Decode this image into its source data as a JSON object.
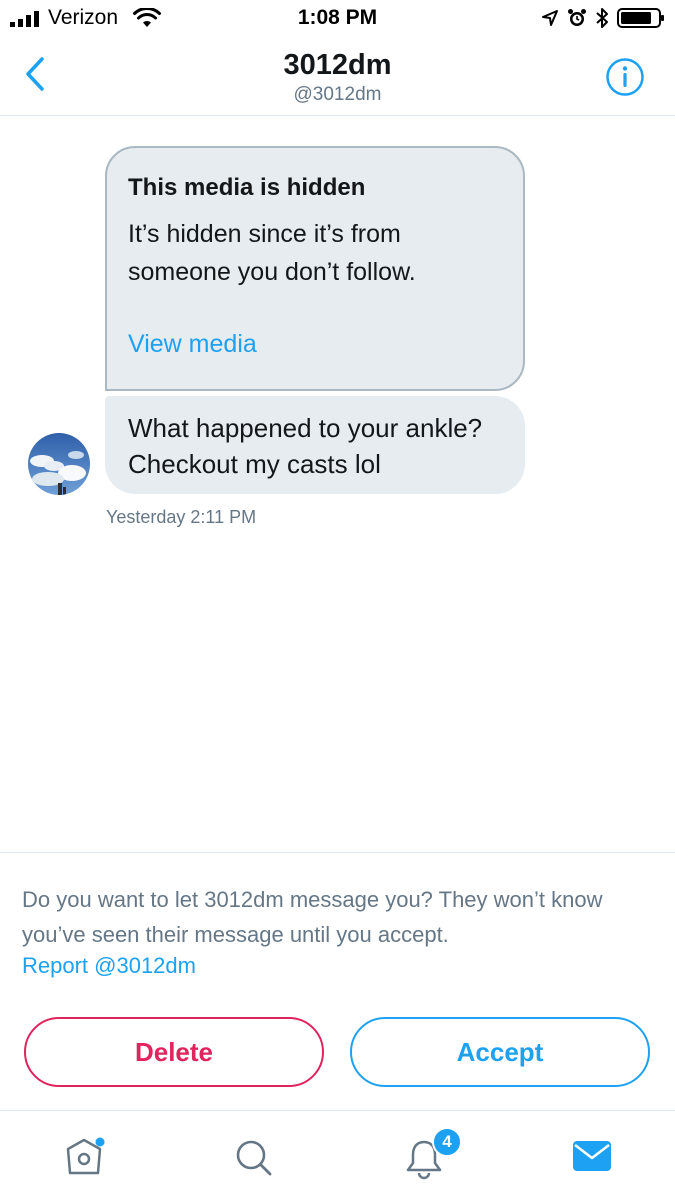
{
  "status_bar": {
    "carrier": "Verizon",
    "time": "1:08 PM",
    "icons": [
      "signal-icon",
      "wifi-icon",
      "location-icon",
      "alarm-icon",
      "bluetooth-icon",
      "battery-icon"
    ]
  },
  "nav": {
    "title": "3012dm",
    "subtitle": "@3012dm",
    "back_icon": "chevron-left-icon",
    "info_icon": "info-icon"
  },
  "conversation": {
    "media_card": {
      "title": "This media is hidden",
      "body": "It’s hidden since it’s from someone you don’t follow.",
      "link": "View media"
    },
    "message": {
      "text": "What happened to your ankle?  Checkout my casts lol",
      "timestamp": "Yesterday 2:11 PM"
    }
  },
  "request": {
    "prompt": "Do you want to let 3012dm message you? They won’t know you’ve seen their message until you accept.",
    "report_link": "Report @3012dm",
    "delete_label": "Delete",
    "accept_label": "Accept"
  },
  "tab_bar": {
    "tabs": [
      {
        "icon": "home-icon",
        "has_dot": true
      },
      {
        "icon": "search-icon"
      },
      {
        "icon": "notifications-icon",
        "badge": "4"
      },
      {
        "icon": "messages-icon",
        "active": true
      }
    ]
  },
  "colors": {
    "accent": "#1da1f2",
    "danger": "#e0245e",
    "bubble": "#e6ecf0",
    "secondary_text": "#657786"
  }
}
